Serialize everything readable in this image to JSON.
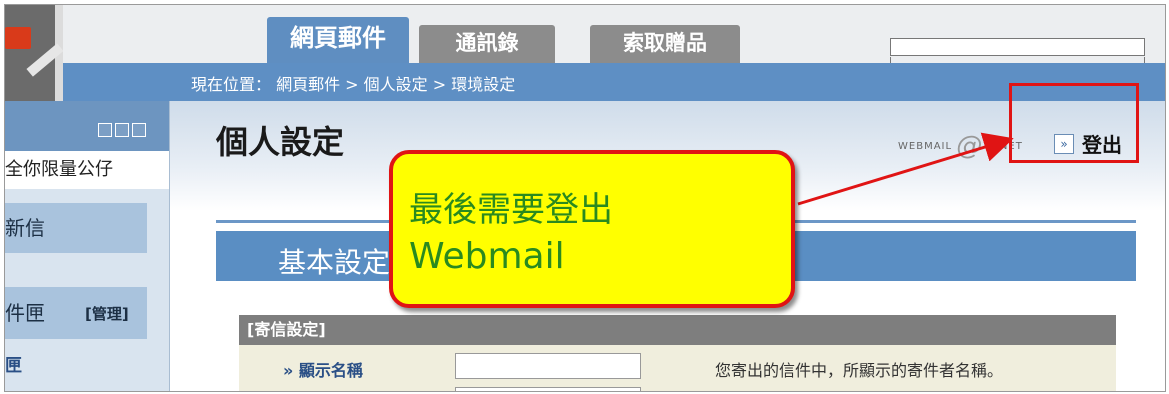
{
  "tabs": {
    "webmail": "網頁郵件",
    "contacts": "通訊錄",
    "gifts": "索取贈品"
  },
  "breadcrumb": "現在位置： 網頁郵件 > 個人設定 > 環境設定",
  "sidebar": {
    "user": "全你限量公仔",
    "compose": "新信",
    "inbox": "件匣",
    "manage": "[管理]",
    "box": "匣"
  },
  "page": {
    "title": "個人設定",
    "brand_text": "WEBMAIL",
    "brand_at": "@",
    "brand_tail": "HINET",
    "logout_label": "登出",
    "section_title": "基本設定"
  },
  "send_settings": {
    "header": "[寄信設定]",
    "display_name_label": "» 顯示名稱",
    "display_name_value": "",
    "display_name_desc": "您寄出的信件中，所顯示的寄件者名稱。"
  },
  "annotation": {
    "line1": "最後需要登出",
    "line2": "Webmail",
    "fill_color": "#ffff00",
    "border_color": "#e01414",
    "text_color": "#2a8a1f"
  },
  "colors": {
    "accent_blue": "#5e8fc4",
    "tab_gray": "#8c8c8c"
  }
}
